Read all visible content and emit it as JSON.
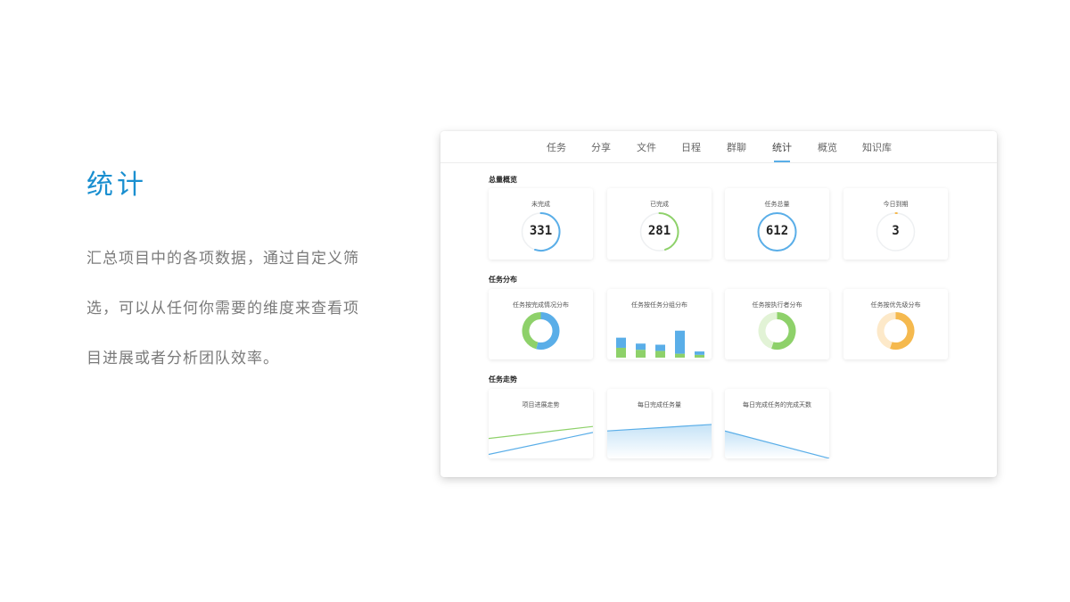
{
  "left": {
    "title": "统计",
    "description": "汇总项目中的各项数据，通过自定义筛选，可以从任何你需要的维度来查看项目进展或者分析团队效率。"
  },
  "tabs": [
    {
      "label": "任务"
    },
    {
      "label": "分享"
    },
    {
      "label": "文件"
    },
    {
      "label": "日程"
    },
    {
      "label": "群聊"
    },
    {
      "label": "统计",
      "active": true
    },
    {
      "label": "概览"
    },
    {
      "label": "知识库"
    }
  ],
  "overview": {
    "section_label": "总量概览",
    "cards": [
      {
        "label": "未完成",
        "value": "331",
        "ring_fraction": 0.55,
        "color": "#5aaee8"
      },
      {
        "label": "已完成",
        "value": "281",
        "ring_fraction": 0.45,
        "color": "#8ed16a"
      },
      {
        "label": "任务总量",
        "value": "612",
        "ring_fraction": 1.0,
        "color": "#5aaee8"
      },
      {
        "label": "今日到期",
        "value": "3",
        "ring_fraction": 0.01,
        "color": "#f5b94e"
      }
    ]
  },
  "distribution": {
    "section_label": "任务分布",
    "cards": [
      {
        "label": "任务按完成情况分布",
        "type": "donut",
        "slices": [
          0.54,
          0.46
        ],
        "colors": [
          "#5aaee8",
          "#8ed16a"
        ]
      },
      {
        "label": "任务按任务分组分布",
        "type": "stacked-bar",
        "stacks": [
          [
            0.35,
            0.36
          ],
          [
            0.28,
            0.22
          ],
          [
            0.24,
            0.22
          ],
          [
            0.14,
            0.82
          ],
          [
            0.1,
            0.12
          ]
        ],
        "colors": [
          "#8ed16a",
          "#5aaee8"
        ]
      },
      {
        "label": "任务按执行者分布",
        "type": "donut",
        "slices": [
          0.55,
          0.45
        ],
        "colors": [
          "#8ed16a",
          "#e2f3d6"
        ]
      },
      {
        "label": "任务按优先级分布",
        "type": "donut",
        "slices": [
          0.55,
          0.45
        ],
        "colors": [
          "#f5b94e",
          "#fde9c9"
        ]
      }
    ]
  },
  "trend": {
    "section_label": "任务走势",
    "cards": [
      {
        "label": "项目进展走势",
        "type": "lines",
        "series": [
          {
            "color": "#8ed16a",
            "values": [
              0.4,
              0.64
            ]
          },
          {
            "color": "#5aaee8",
            "values": [
              0.08,
              0.52
            ]
          }
        ]
      },
      {
        "label": "每日完成任务量",
        "type": "area",
        "series": [
          {
            "color": "#5aaee8",
            "values": [
              0.55,
              0.68
            ]
          }
        ]
      },
      {
        "label": "每日完成任务的完成天数",
        "type": "area",
        "series": [
          {
            "color": "#5aaee8",
            "values": [
              0.55,
              0.0
            ]
          }
        ]
      }
    ]
  }
}
